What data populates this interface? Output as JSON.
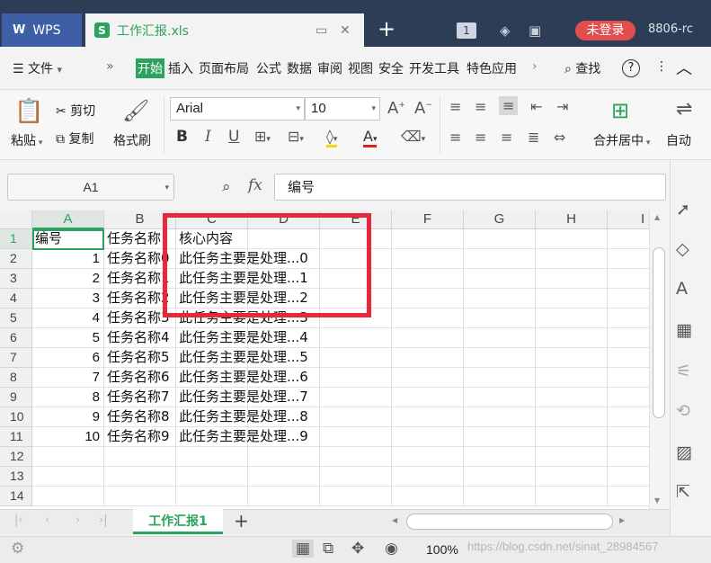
{
  "titlebar": {
    "app_tab": "WPS",
    "doc_tab": "工作汇报.xls",
    "doc_icon": "S",
    "tab_count": "1",
    "login_label": "未登录",
    "user_id": "8806-rc"
  },
  "menu": {
    "file_label": "文件",
    "items": [
      "开始",
      "插入",
      "页面布局",
      "公式",
      "数据",
      "审阅",
      "视图",
      "安全",
      "开发工具",
      "特色应用"
    ],
    "search_label": "查找",
    "help_icon": "?"
  },
  "ribbon": {
    "paste_label": "粘贴",
    "cut_label": "剪切",
    "copy_label": "复制",
    "format_painter_label": "格式刷",
    "font_name": "Arial",
    "font_size": "10",
    "merge_label": "合并居中",
    "auto_label": "自动"
  },
  "formula_bar": {
    "name_box": "A1",
    "fx_label": "fx",
    "content": "编号"
  },
  "grid": {
    "columns": [
      "A",
      "B",
      "C",
      "D",
      "E",
      "F",
      "G",
      "H",
      "I"
    ],
    "row_numbers": [
      "1",
      "2",
      "3",
      "4",
      "5",
      "6",
      "7",
      "8",
      "9",
      "10",
      "11",
      "12",
      "13",
      "14"
    ],
    "header_row": {
      "a": "编号",
      "b": "任务名称",
      "c": "核心内容"
    },
    "rows": [
      {
        "a": "1",
        "b": "任务名称0",
        "c": "此任务主要是处理...0"
      },
      {
        "a": "2",
        "b": "任务名称1",
        "c": "此任务主要是处理...1"
      },
      {
        "a": "3",
        "b": "任务名称2",
        "c": "此任务主要是处理...2"
      },
      {
        "a": "4",
        "b": "任务名称3",
        "c": "此任务主要是处理...3"
      },
      {
        "a": "5",
        "b": "任务名称4",
        "c": "此任务主要是处理...4"
      },
      {
        "a": "6",
        "b": "任务名称5",
        "c": "此任务主要是处理...5"
      },
      {
        "a": "7",
        "b": "任务名称6",
        "c": "此任务主要是处理...6"
      },
      {
        "a": "8",
        "b": "任务名称7",
        "c": "此任务主要是处理...7"
      },
      {
        "a": "9",
        "b": "任务名称8",
        "c": "此任务主要是处理...8"
      },
      {
        "a": "10",
        "b": "任务名称9",
        "c": "此任务主要是处理...9"
      }
    ]
  },
  "sheets": {
    "active": "工作汇报1",
    "add_label": "+"
  },
  "status": {
    "zoom": "100%",
    "watermark": "https://blog.csdn.net/sinat_28984567"
  },
  "colors": {
    "titlebar_bg": "#2d3d55",
    "accent_green": "#2ca35c",
    "highlight_red": "#e8283a",
    "login_red": "#e24d4d"
  }
}
